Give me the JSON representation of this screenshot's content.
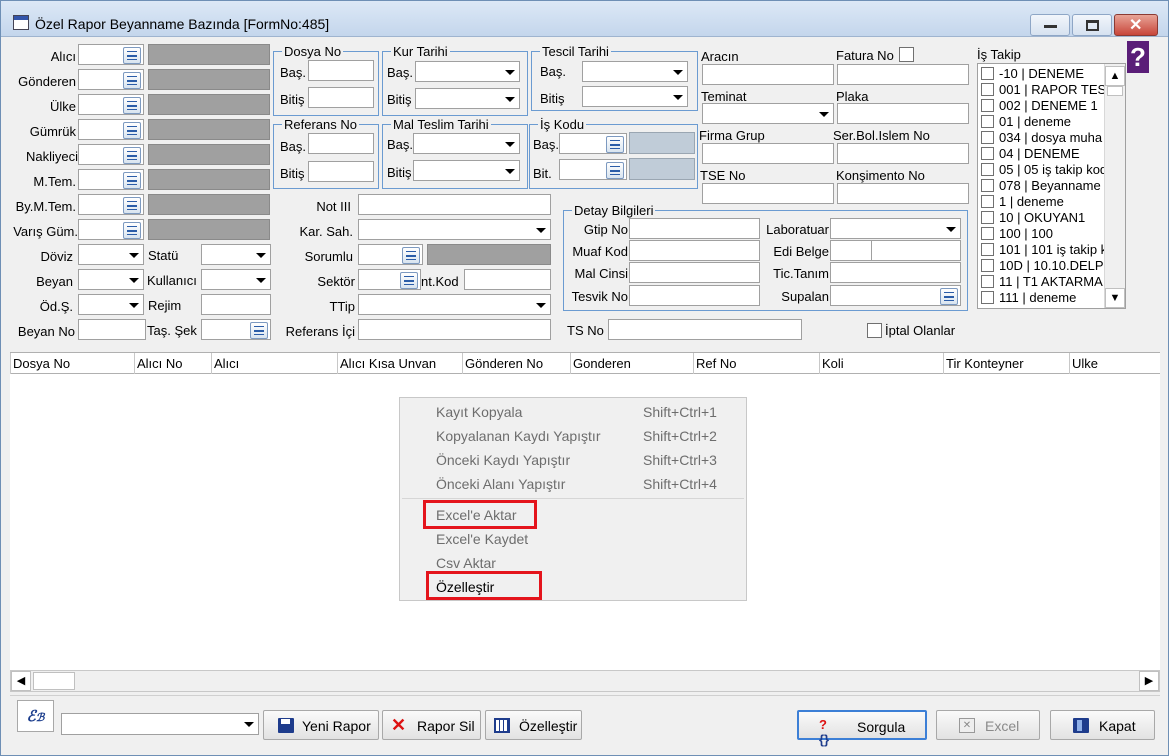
{
  "window": {
    "title": "Özel Rapor Beyanname Bazında [FormNo:485]"
  },
  "left_labels": {
    "alici": "Alıcı",
    "gonderen": "Gönderen",
    "ulke": "Ülke",
    "gumruk": "Gümrük",
    "nakliyeci": "Nakliyeci",
    "mtem": "M.Tem.",
    "bymtem": "By.M.Tem.",
    "varis": "Varış Güm.",
    "doviz": "Döviz",
    "beyan": "Beyan",
    "ods": "Öd.Ş.",
    "beyan_no": "Beyan No",
    "statu": "Statü",
    "kullanici": "Kullanıcı",
    "rejim": "Rejim",
    "tas_sek": "Taş. Şek"
  },
  "groups": {
    "dosya_no": "Dosya No",
    "kur_tarihi": "Kur Tarihi",
    "tescil_tarihi": "Tescil Tarihi",
    "referans_no": "Referans No",
    "mal_teslim": "Mal Teslim Tarihi",
    "is_kodu": "İş Kodu",
    "detay": "Detay Bilgileri"
  },
  "range": {
    "bas": "Baş.",
    "bitis": "Bitiş",
    "bit": "Bit."
  },
  "mid_labels": {
    "not": "Not III",
    "kar_sah": "Kar. Sah.",
    "sorumlu": "Sorumlu",
    "sektor": "Sektör",
    "int_kod": "nt.Kod",
    "ttip": "TTip",
    "referans_ici": "Referans İçi"
  },
  "right_labels": {
    "aracin": "Aracın",
    "fatura_no": "Fatura No",
    "teminat": "Teminat",
    "plaka": "Plaka",
    "firma_grup": "Firma Grup",
    "ser_bol": "Ser.Bol.Islem No",
    "tse": "TSE No",
    "konsimento": "Konşimento No",
    "is_takip": "İş Takip"
  },
  "detay": {
    "gtip": "Gtip No",
    "muaf": "Muaf Kod",
    "mal_cinsi": "Mal Cinsi",
    "tesvik": "Tesvik No",
    "lab": "Laboratuar",
    "edi": "Edi Belge",
    "tic": "Tic.Tanım",
    "supalan": "Supalan"
  },
  "ts_no": "TS No",
  "iptal": "İptal Olanlar",
  "is_takip_items": [
    "-10 | DENEME",
    "001 | RAPOR TES",
    "002 | DENEME 1",
    "01 | deneme",
    "034 | dosya muha",
    "04 | DENEME",
    "05 | 05 iş takip kod",
    "078 | Beyanname",
    "1 | deneme",
    "10 | OKUYAN1",
    "100 | 100",
    "101 | 101 iş takip k",
    "10D | 10.10.DELPH",
    "11 | T1 AKTARMA",
    "111 | deneme"
  ],
  "columns": [
    "Dosya No",
    "Alıcı No",
    "Alıcı",
    "Alıcı Kısa Unvan",
    "Gönderen No",
    "Gonderen",
    "Ref No",
    "Koli",
    "Tir Konteyner",
    "Ulke"
  ],
  "context_menu": [
    {
      "label": "Kayıt Kopyala",
      "shortcut": "Shift+Ctrl+1"
    },
    {
      "label": "Kopyalanan Kaydı Yapıştır",
      "shortcut": "Shift+Ctrl+2"
    },
    {
      "label": "Önceki Kaydı Yapıştır",
      "shortcut": "Shift+Ctrl+3"
    },
    {
      "label": "Önceki Alanı Yapıştır",
      "shortcut": "Shift+Ctrl+4"
    },
    {
      "label": "Excel'e Aktar",
      "shortcut": ""
    },
    {
      "label": "Excel'e Kaydet",
      "shortcut": ""
    },
    {
      "label": "Csv Aktar",
      "shortcut": ""
    },
    {
      "label": "Özelleştir",
      "shortcut": ""
    }
  ],
  "buttons": {
    "yeni_rapor": "Yeni Rapor",
    "rapor_sil": "Rapor Sil",
    "ozellestir": "Özelleştir",
    "sorgula": "Sorgula",
    "excel": "Excel",
    "kapat": "Kapat"
  },
  "colors": {
    "title_bg": "#c4d6ec",
    "highlight": "#e4141c",
    "group_border": "#6b9bd1"
  }
}
